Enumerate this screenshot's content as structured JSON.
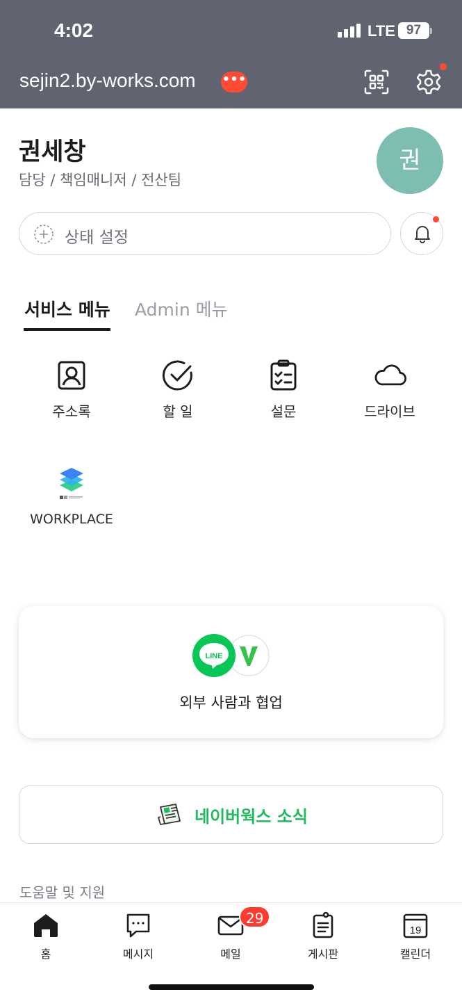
{
  "status_bar": {
    "time": "4:02",
    "network": "LTE",
    "battery": "97"
  },
  "header": {
    "domain": "sejin2.by-works.com",
    "more_icon": "more-dots-icon",
    "qr_icon": "qr-scan-icon",
    "settings_icon": "gear-icon"
  },
  "profile": {
    "name": "권세창",
    "title": "담당 / 책임매니저 / 전산팀",
    "avatar_initial": "권",
    "avatar_color": "#7ebdb1"
  },
  "status_field": {
    "placeholder": "상태 설정"
  },
  "tabs": [
    {
      "label": "서비스 메뉴",
      "active": true
    },
    {
      "label": "Admin 메뉴",
      "active": false
    }
  ],
  "services": [
    {
      "label": "주소록",
      "icon": "contact-card-icon"
    },
    {
      "label": "할 일",
      "icon": "check-circle-icon"
    },
    {
      "label": "설문",
      "icon": "clipboard-checklist-icon"
    },
    {
      "label": "드라이브",
      "icon": "cloud-icon"
    },
    {
      "label": "WORKPLACE",
      "icon": "workplace-layers-icon"
    }
  ],
  "collab_card": {
    "label": "외부 사람과 협업",
    "line_logo_text": "LINE",
    "works_logo_text": "W"
  },
  "news_card": {
    "label": "네이버웍스 소식",
    "icon": "newspaper-icon"
  },
  "help_section": {
    "title": "도움말 및 지원"
  },
  "bottom_nav": [
    {
      "label": "홈",
      "icon": "home-icon",
      "active": true
    },
    {
      "label": "메시지",
      "icon": "chat-bubble-icon"
    },
    {
      "label": "메일",
      "icon": "mail-icon",
      "badge": "29"
    },
    {
      "label": "게시판",
      "icon": "board-icon"
    },
    {
      "label": "캘린더",
      "icon": "calendar-icon",
      "date": "19"
    }
  ],
  "colors": {
    "header_bg": "#5f6470",
    "accent_green": "#1fba5b",
    "badge_red": "#ff3b30",
    "line_green": "#06c755"
  }
}
